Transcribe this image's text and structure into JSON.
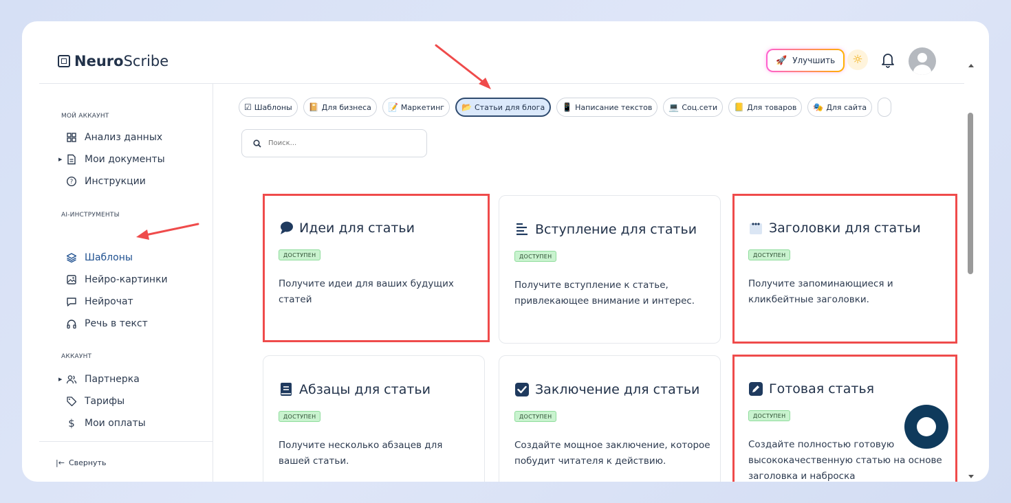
{
  "brand": {
    "bold": "Neuro",
    "light": "Scribe"
  },
  "header": {
    "upgrade_label": "Улучшить"
  },
  "sidebar": {
    "section_account": "МОЙ АККАУНТ",
    "item_analysis": "Анализ данных",
    "item_documents": "Мои документы",
    "item_instructions": "Инструкции",
    "section_ai": "AI-ИНСТРУМЕНТЫ",
    "item_templates": "Шаблоны",
    "item_images": "Нейро-картинки",
    "item_chat": "Нейрочат",
    "item_speech": "Речь в текст",
    "section_acc2": "АККАУНТ",
    "item_partner": "Партнерка",
    "item_tariffs": "Тарифы",
    "item_payments": "Мои оплаты",
    "collapse": "Свернуть"
  },
  "chips": {
    "templates": "Шаблоны",
    "business": "Для бизнеса",
    "marketing": "Маркетинг",
    "blog": "Статьи для блога",
    "writing": "Написание текстов",
    "social": "Соц.сети",
    "products": "Для товаров",
    "site": "Для сайта"
  },
  "search": {
    "placeholder": "Поиск..."
  },
  "badge_label": "ДОСТУПЕН",
  "cards": [
    {
      "title": "Идеи для статьи",
      "desc": "Получите идеи для ваших будущих статей"
    },
    {
      "title": "Вступление для статьи",
      "desc": "Получите вступление к статье, привлекающее внимание и интерес."
    },
    {
      "title": "Заголовки для статьи",
      "desc": "Получите запоминающиеся и кликбейтные заголовки."
    },
    {
      "title": "Абзацы для статьи",
      "desc": "Получите несколько абзацев для вашей статьи."
    },
    {
      "title": "Заключение для статьи",
      "desc": "Создайте мощное заключение, которое побудит читателя к действию."
    },
    {
      "title": "Готовая статья",
      "desc": "Создайте полностью готовую высококачественную статью на основе заголовка и наброска"
    }
  ],
  "colors": {
    "accent": "#1d4f8f",
    "highlight": "#ef4b4b",
    "fab": "#0f3a5c",
    "badge_bg": "#c9f3cf"
  }
}
